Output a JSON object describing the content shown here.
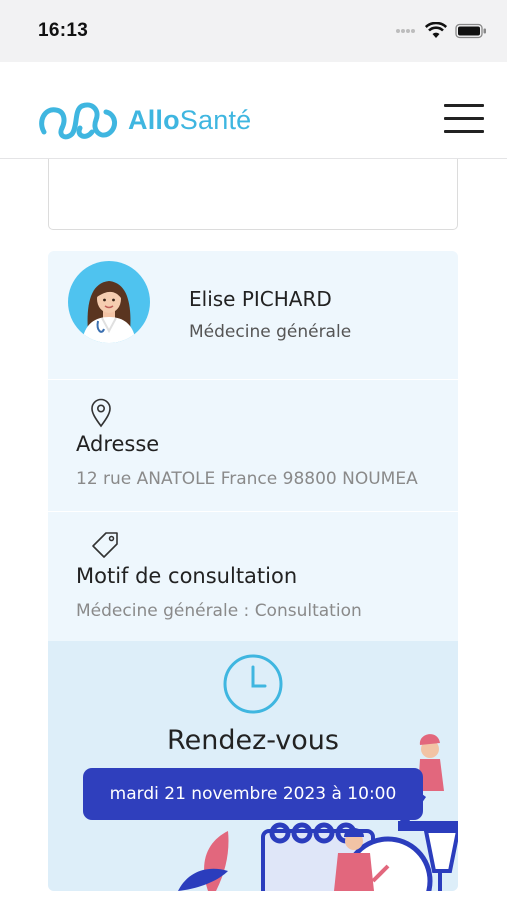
{
  "status_bar": {
    "time": "16:13"
  },
  "header": {
    "brand_part1": "Allo",
    "brand_part2": "Santé",
    "brand_color": "#3fb6e0"
  },
  "doctor": {
    "name": "Elise PICHARD",
    "specialty": "Médecine générale"
  },
  "address": {
    "label": "Adresse",
    "value": "12 rue ANATOLE France 98800 NOUMEA",
    "icon": "location-pin-icon"
  },
  "motif": {
    "label": "Motif de consultation",
    "value": "Médecine générale : Consultation",
    "icon": "tag-icon"
  },
  "appointment": {
    "label": "Rendez-vous",
    "date": "mardi 21 novembre 2023 à 10:00",
    "icon": "clock-icon",
    "accent": "#2f3fbd"
  }
}
